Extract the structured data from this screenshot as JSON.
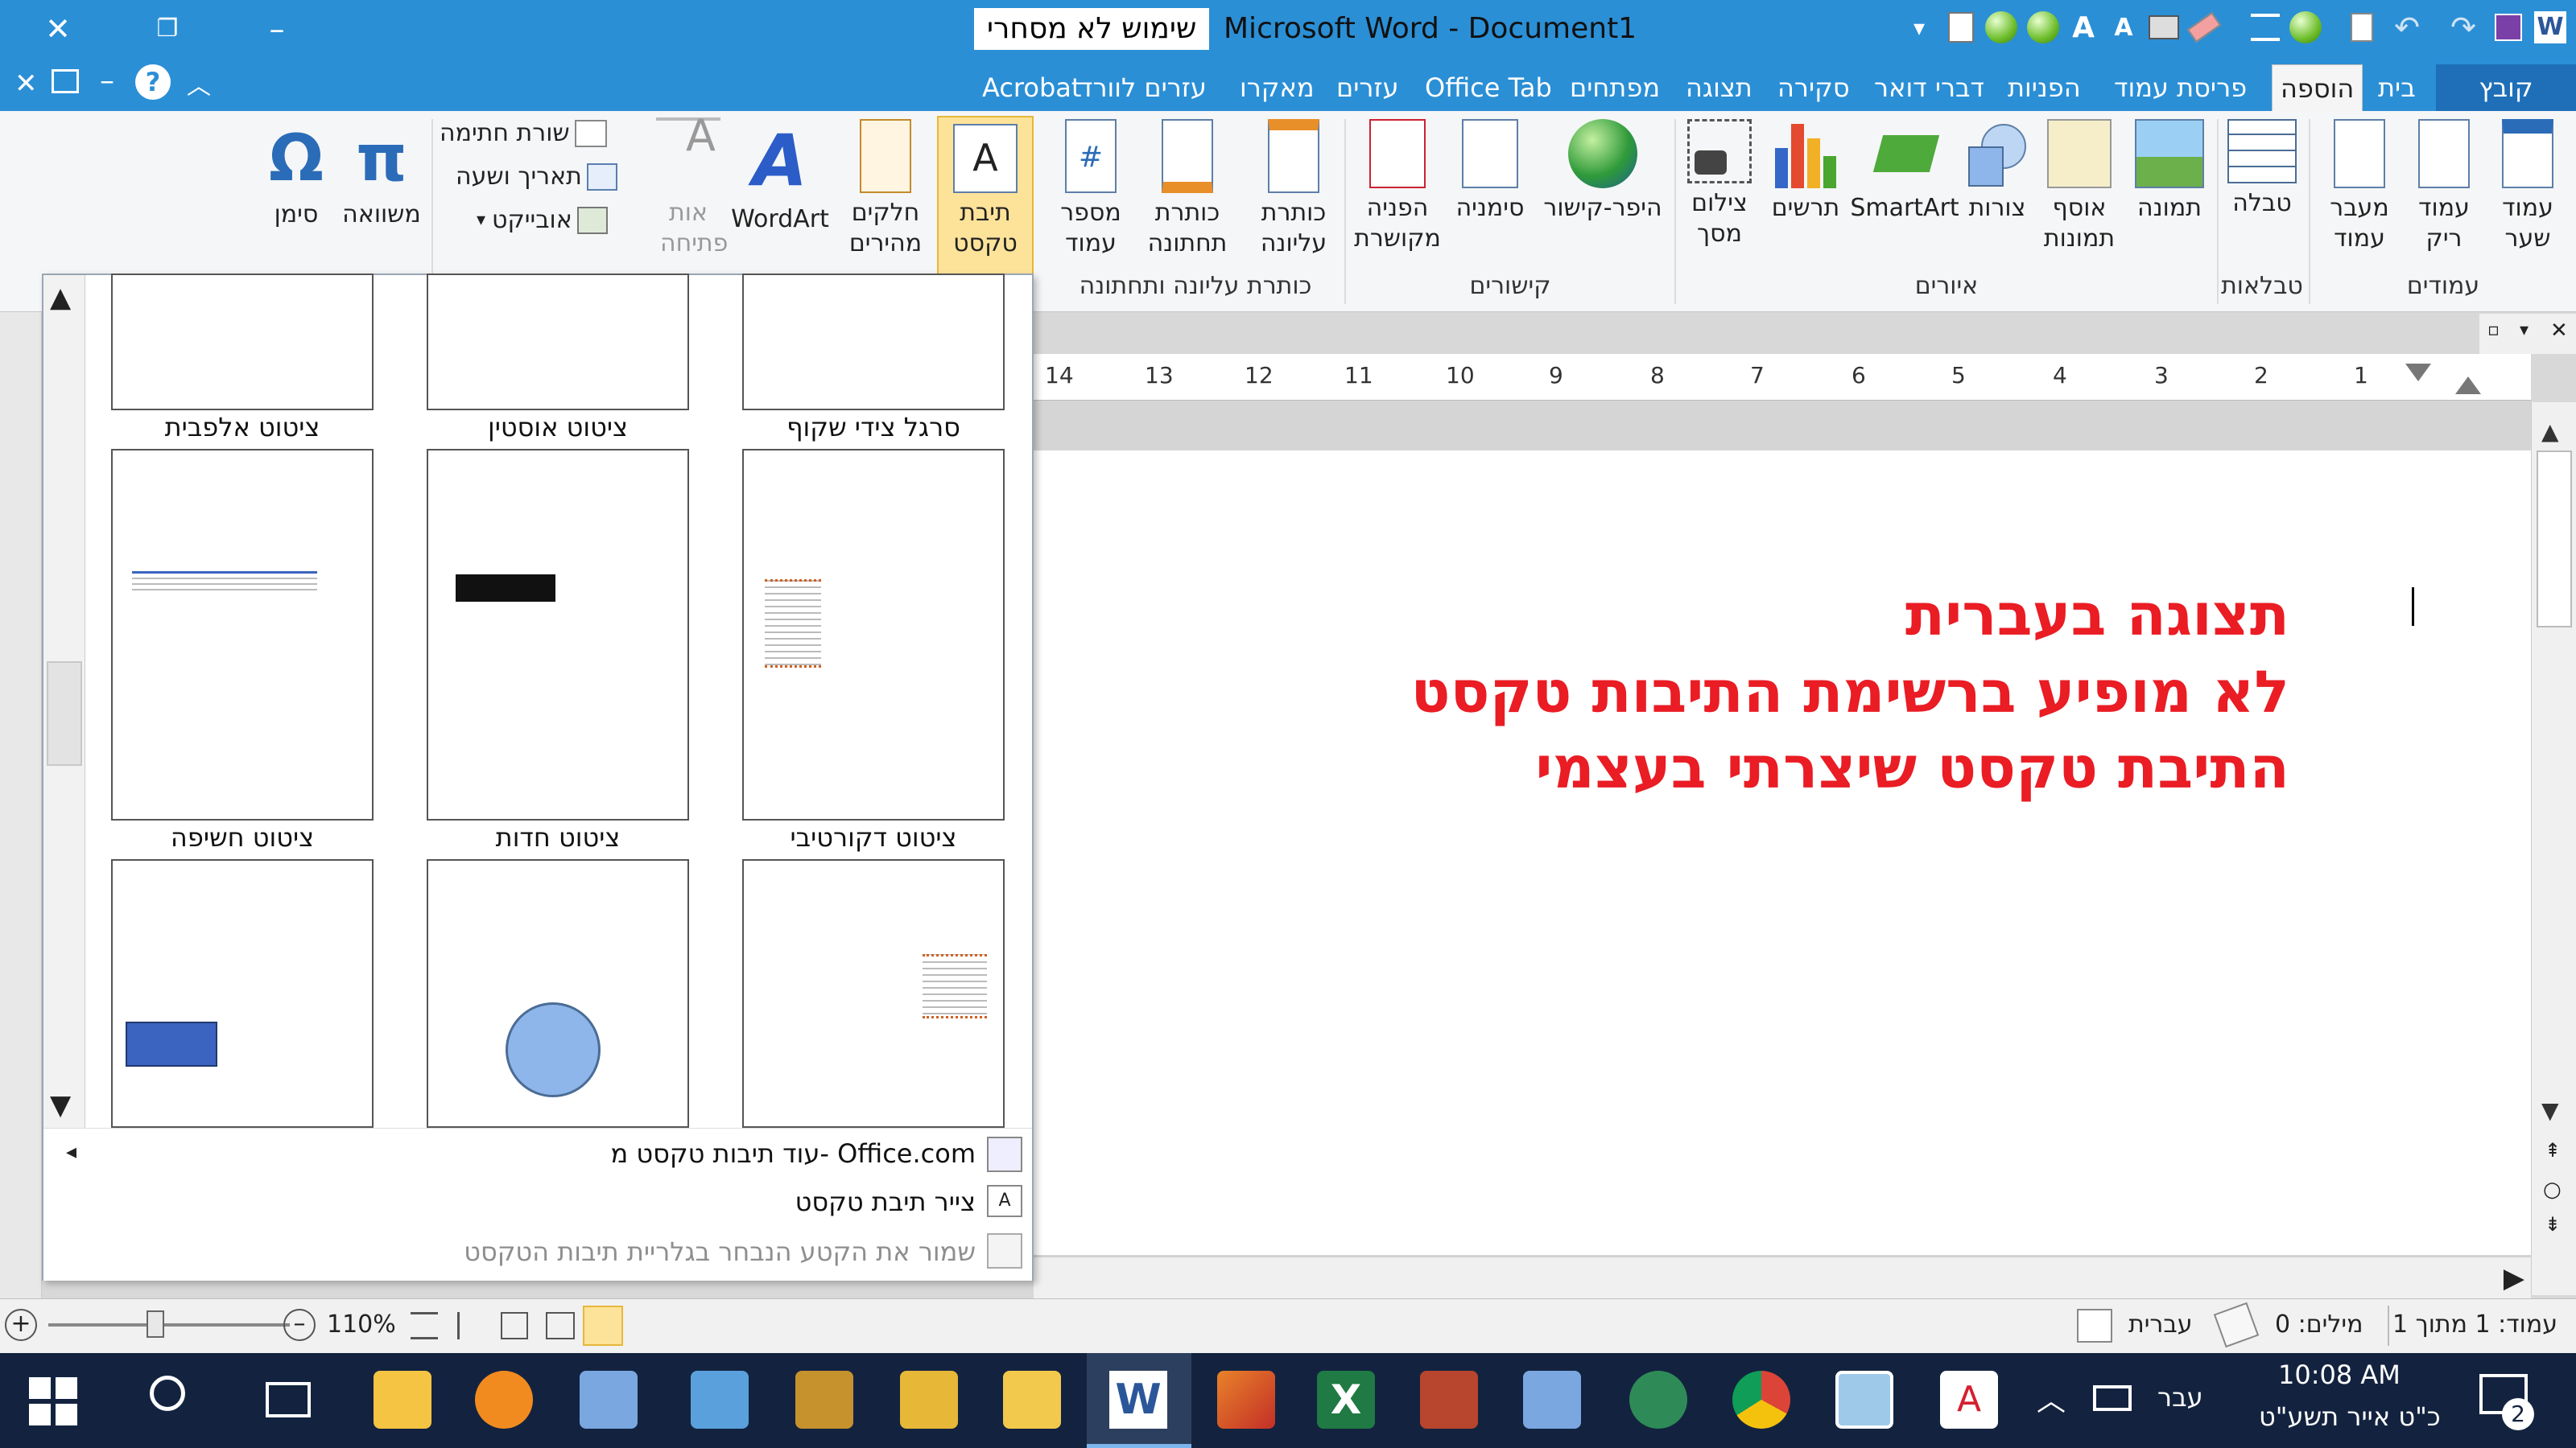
{
  "window": {
    "title_highlight": "שימוש לא מסחרי",
    "title": "Microsoft Word - Document1",
    "close": "✕",
    "restore": "❐",
    "minimize": "–"
  },
  "tabs": {
    "file": "קובץ",
    "home": "בית",
    "insert": "הוספה",
    "page_layout": "פריסת עמוד",
    "references": "הפניות",
    "mailings": "דברי דואר",
    "review": "סקירה",
    "view": "תצוגה",
    "developer": "מפתחים",
    "office_tab": "Office Tab",
    "help": "עזרים",
    "macro": "מאקרו",
    "download_help": "עזרים לוורד",
    "acrobat": "Acrobat"
  },
  "ribbon": {
    "pages": {
      "cover": "עמוד שער",
      "blank": "עמוד ריק",
      "break": "מעבר עמוד",
      "group": "עמודים"
    },
    "tables": {
      "table": "טבלה",
      "group": "טבלאות"
    },
    "illustrations": {
      "picture": "תמונה",
      "clipart": "אוסף תמונות",
      "shapes": "צורות",
      "smartart": "SmartArt",
      "chart": "תרשים",
      "screenshot": "צילום מסך",
      "group": "איורים"
    },
    "links": {
      "hyperlink": "היפר-קישור",
      "bookmark": "סימניה",
      "crossref": "הפניה מקושרת",
      "group": "קישורים"
    },
    "header_footer": {
      "header": "כותרת עליונה",
      "footer": "כותרת תחתונה",
      "page_number": "מספר עמוד",
      "group": "כותרת עליונה ותחתונה"
    },
    "text": {
      "textbox": "תיבת טקסט",
      "quickparts": "חלקים מהירים",
      "wordart": "WordArt",
      "dropcap": "אות פתיחה",
      "signature": "שורת חתימה",
      "datetime": "תאריך ושעה",
      "object": "אובייקט"
    },
    "symbols": {
      "equation": "משוואה",
      "symbol": "סימן"
    }
  },
  "gallery": {
    "items": [
      {
        "label": "סרגל צידי שקוף"
      },
      {
        "label": "ציטוט אוסטין"
      },
      {
        "label": "ציטוט אלפבית"
      },
      {
        "label": "ציטוט דקורטיבי"
      },
      {
        "label": "ציטוט חדות"
      },
      {
        "label": "ציטוט חשיפה"
      }
    ],
    "more_from_office": "עוד תיבות טקסט מ- Office.com",
    "draw_textbox": "צייר תיבת טקסט",
    "save_selection": "שמור את הקטע הנבחר בגלריית תיבות הטקסט"
  },
  "document": {
    "line1": "תצוגה בעברית",
    "line2": "לא מופיע ברשימת התיבות טקסט",
    "line3": "התיבת טקסט שיצרתי בעצמי"
  },
  "ruler": [
    "14",
    "13",
    "12",
    "11",
    "10",
    "9",
    "8",
    "7",
    "6",
    "5",
    "4",
    "3",
    "2",
    "1"
  ],
  "status": {
    "page": "עמוד: 1 מתוך 1",
    "words": "מילים: 0",
    "language": "עברית",
    "zoom": "110%"
  },
  "taskbar": {
    "time": "10:08 AM",
    "date": "כ\"ט אייר תשע\"ט",
    "lang": "עבר",
    "notifications": "2"
  },
  "colors": {
    "titlebar": "#2b8fd6",
    "accent_red": "#ea1c24",
    "taskbar": "#13233f"
  }
}
